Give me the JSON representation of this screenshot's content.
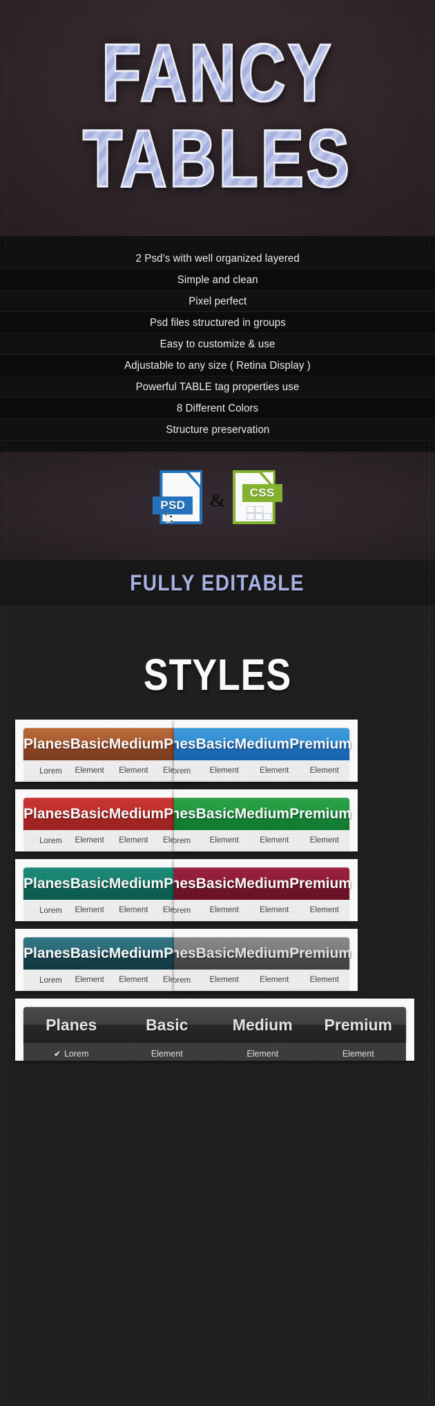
{
  "hero": {
    "line1": "FANCY",
    "line2": "TABLES"
  },
  "features": {
    "items": [
      "2 Psd’s with well organized layered",
      "Simple and clean",
      "Pixel perfect",
      "Psd files structured in groups",
      "Easy to customize & use",
      "Adjustable to  any size ( Retina Display )",
      "Powerful TABLE tag properties use",
      "8 Different Colors",
      "Structure preservation"
    ]
  },
  "files": {
    "psd_label": "PSD",
    "css_label": "CSS",
    "separator": "&"
  },
  "editable": {
    "label": "FULLY EDITABLE"
  },
  "styles": {
    "heading": "STYLES",
    "columns": [
      "Planes",
      "Basic",
      "Medium",
      "Premium"
    ],
    "row_cells": [
      "Lorem",
      "Element",
      "Element",
      "Element"
    ],
    "check_glyph": "✔",
    "cards": [
      {
        "name": "orange",
        "color": "#ab5a2c",
        "class": "g-orange"
      },
      {
        "name": "blue",
        "color": "#2f8fd8",
        "class": "g-blue"
      },
      {
        "name": "red",
        "color": "#c02b28",
        "class": "g-red"
      },
      {
        "name": "green",
        "color": "#1e9a3d",
        "class": "g-green"
      },
      {
        "name": "teal",
        "color": "#13806f",
        "class": "g-teal"
      },
      {
        "name": "maroon",
        "color": "#8e1835",
        "class": "g-maroon"
      },
      {
        "name": "darkteal",
        "color": "#2a6a78",
        "class": "g-darkteal"
      },
      {
        "name": "gray",
        "color": "#7b7b7b",
        "class": "g-gray"
      },
      {
        "name": "dark",
        "color": "#3d3d3d",
        "class": "g-dark"
      }
    ]
  },
  "theme": {
    "hero_bg": "#2e2327",
    "hero_text": "#aab4e4",
    "features_bg": "#0c0c0c",
    "styles_bg": "#1c1c1c",
    "accent": "#a8b4e8"
  }
}
